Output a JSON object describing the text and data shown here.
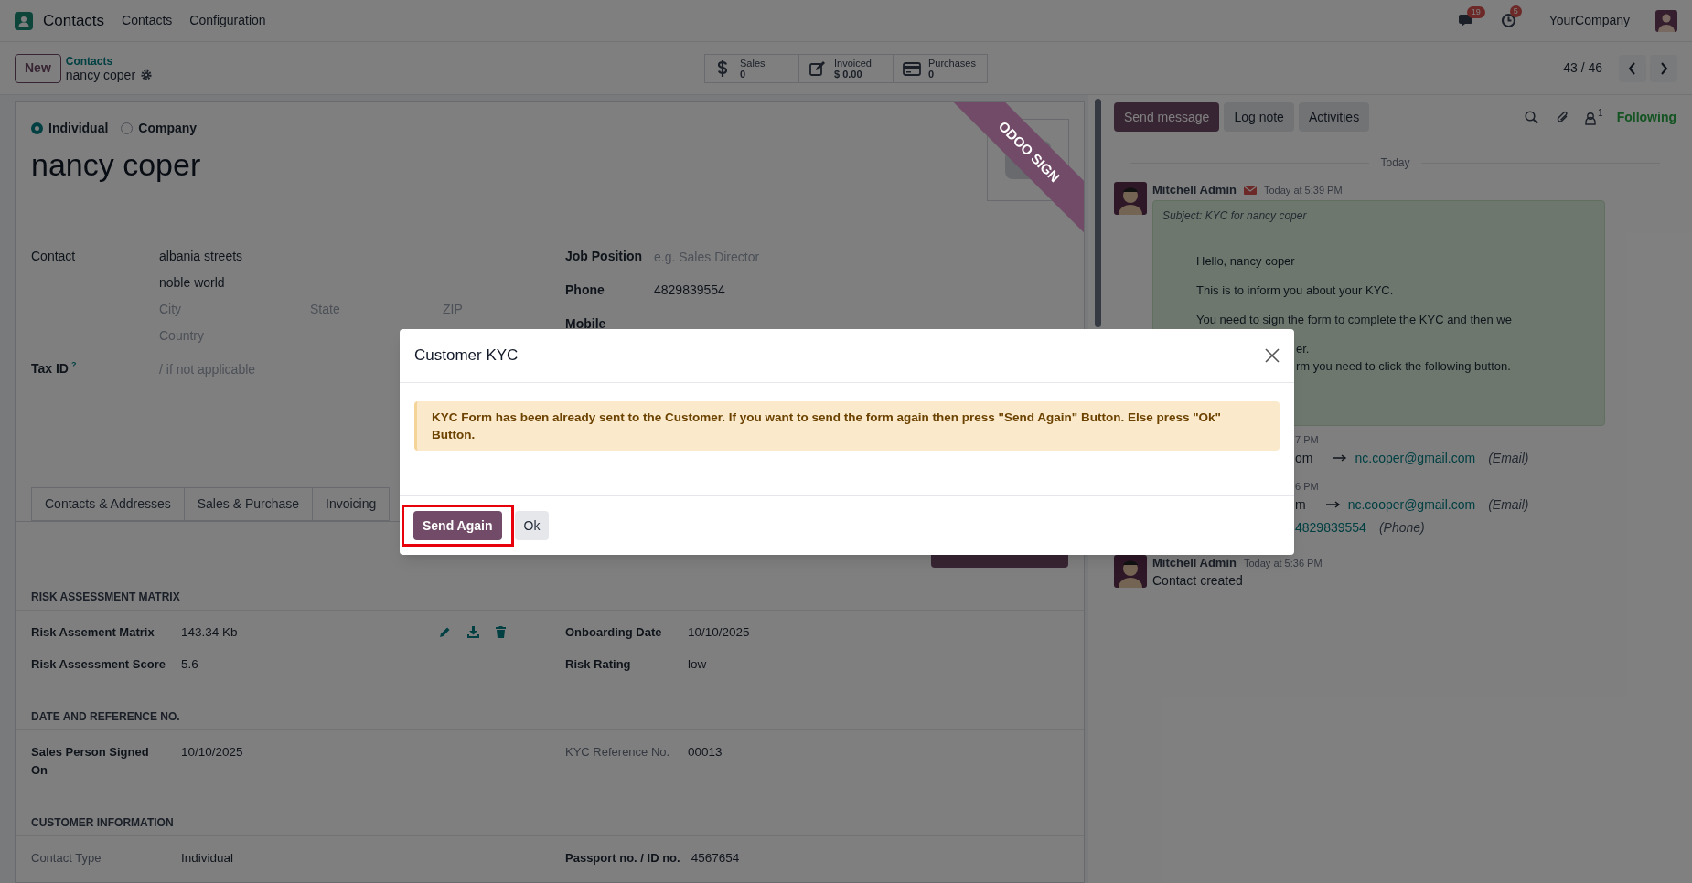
{
  "navbar": {
    "app": "Contacts",
    "menu": [
      "Contacts",
      "Configuration"
    ],
    "messages_badge": "19",
    "activities_badge": "5",
    "company": "YourCompany"
  },
  "control_panel": {
    "new_button": "New",
    "breadcrumb": "Contacts",
    "record": "nancy coper",
    "stats": [
      {
        "kind": "sales",
        "label": "Sales",
        "value": "0"
      },
      {
        "kind": "invoiced",
        "label": "Invoiced",
        "value": "$ 0.00"
      },
      {
        "kind": "purchases",
        "label": "Purchases",
        "value": "0"
      }
    ],
    "pager": "43 / 46"
  },
  "form": {
    "company_type": [
      {
        "label": "Individual",
        "selected": true
      },
      {
        "label": "Company",
        "selected": false
      }
    ],
    "name": "nancy coper",
    "ribbon": "ODOO SIGN",
    "address": {
      "label": "Contact",
      "street": "albania streets",
      "street2": "noble world",
      "city_placeholder": "City",
      "state_placeholder": "State",
      "zip_placeholder": "ZIP",
      "country_placeholder": "Country"
    },
    "tax_id": {
      "label": "Tax ID",
      "help": "?",
      "placeholder": "/ if not applicable"
    },
    "right_fields": [
      {
        "label": "Job Position",
        "placeholder": "e.g. Sales Director"
      },
      {
        "label": "Phone",
        "value": "4829839554"
      },
      {
        "label": "Mobile"
      }
    ],
    "tabs": [
      {
        "label": "Contacts & Addresses",
        "selected": false
      },
      {
        "label": "Sales & Purchase",
        "selected": false
      },
      {
        "label": "Invoicing",
        "selected": false
      }
    ],
    "sections": [
      {
        "title": "RISK ASSESSMENT MATRIX",
        "rows": [
          [
            {
              "kind": "binary",
              "label": "Risk Assement Matrix",
              "value": "143.34 Kb",
              "muted": false
            },
            {
              "kind": "text",
              "label": "Onboarding Date",
              "value": "10/10/2025",
              "muted": false
            }
          ],
          [
            {
              "kind": "text",
              "label": "Risk Assessment Score",
              "value": "5.6",
              "muted": false
            },
            {
              "kind": "text",
              "label": "Risk Rating",
              "value": "low",
              "muted": false
            }
          ]
        ]
      },
      {
        "title": "DATE AND REFERENCE NO.",
        "rows": [
          [
            {
              "kind": "text",
              "label": "Sales Person Signed On",
              "value": "10/10/2025",
              "muted": false
            },
            {
              "kind": "text",
              "label": "KYC Reference No.",
              "value": "00013",
              "muted": true
            }
          ]
        ]
      },
      {
        "title": "CUSTOMER INFORMATION",
        "rows": [
          [
            {
              "kind": "text",
              "label": "Contact Type",
              "value": "Individual",
              "muted": true
            },
            {
              "kind": "text",
              "label": "Passport no. / ID no.",
              "value": "4567654",
              "muted": false
            }
          ]
        ]
      }
    ]
  },
  "chatter": {
    "buttons": [
      {
        "label": "Send message",
        "selected": true
      },
      {
        "label": "Log note",
        "selected": false
      },
      {
        "label": "Activities",
        "selected": false
      }
    ],
    "follower_count": "1",
    "follow_label": "Following",
    "date_separator": "Today",
    "messages": [
      {
        "kind": "mail",
        "author": "Mitchell Admin",
        "time": "Today at 5:39 PM",
        "subject": "Subject: KYC for nancy coper",
        "lines": [
          "Hello, nancy coper",
          "This is to inform you about your KYC.",
          "You need to sign the form to complete the KYC and then we"
        ],
        "covered_lines": [
          "er.",
          "rm you need to click the following button."
        ]
      },
      {
        "kind": "tracking",
        "time": "7 PM",
        "changes": [
          {
            "old": "om",
            "new": "nc.coper@gmail.com",
            "field": "(Email)"
          }
        ]
      },
      {
        "kind": "tracking",
        "time": "6 PM",
        "changes": [
          {
            "old": "m",
            "new": "nc.cooper@gmail.com",
            "field": "(Email)"
          },
          {
            "new": "4829839554",
            "field": "(Phone)"
          }
        ]
      },
      {
        "kind": "note",
        "author": "Mitchell Admin",
        "time": "Today at 5:36 PM",
        "body": "Contact created"
      }
    ]
  },
  "dialog": {
    "title": "Customer KYC",
    "message": "KYC Form has been already sent to the Customer. If you want to send the form again then press \"Send Again\" Button. Else press \"Ok\" Button.",
    "buttons": [
      {
        "label": "Send Again",
        "kind": "primary",
        "highlighted": true
      },
      {
        "label": "Ok",
        "kind": "secondary",
        "highlighted": false
      }
    ]
  }
}
